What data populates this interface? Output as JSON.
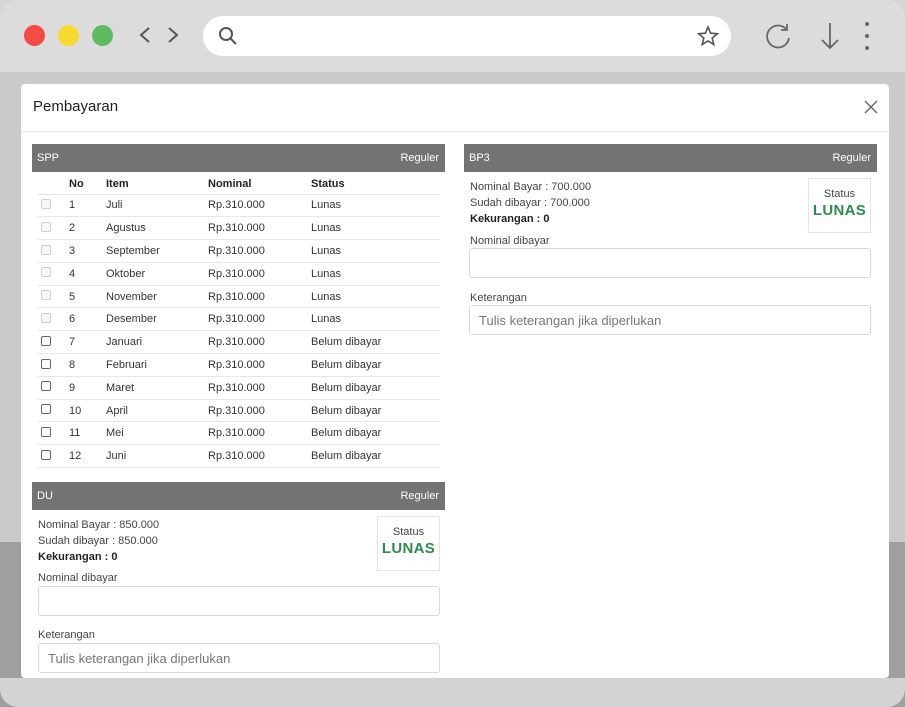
{
  "modal": {
    "title": "Pembayaran"
  },
  "spp": {
    "title": "SPP",
    "type": "Reguler",
    "headers": [
      "No",
      "Item",
      "Nominal",
      "Status"
    ],
    "rows": [
      {
        "no": "1",
        "item": "Juli",
        "nominal": "Rp.310.000",
        "status": "Lunas",
        "paid": true
      },
      {
        "no": "2",
        "item": "Agustus",
        "nominal": "Rp.310.000",
        "status": "Lunas",
        "paid": true
      },
      {
        "no": "3",
        "item": "September",
        "nominal": "Rp.310.000",
        "status": "Lunas",
        "paid": true
      },
      {
        "no": "4",
        "item": "Oktober",
        "nominal": "Rp.310.000",
        "status": "Lunas",
        "paid": true
      },
      {
        "no": "5",
        "item": "November",
        "nominal": "Rp.310.000",
        "status": "Lunas",
        "paid": true
      },
      {
        "no": "6",
        "item": "Desember",
        "nominal": "Rp.310.000",
        "status": "Lunas",
        "paid": true
      },
      {
        "no": "7",
        "item": "Januari",
        "nominal": "Rp.310.000",
        "status": "Belum dibayar",
        "paid": false
      },
      {
        "no": "8",
        "item": "Februari",
        "nominal": "Rp.310.000",
        "status": "Belum dibayar",
        "paid": false
      },
      {
        "no": "9",
        "item": "Maret",
        "nominal": "Rp.310.000",
        "status": "Belum dibayar",
        "paid": false
      },
      {
        "no": "10",
        "item": "April",
        "nominal": "Rp.310.000",
        "status": "Belum dibayar",
        "paid": false
      },
      {
        "no": "11",
        "item": "Mei",
        "nominal": "Rp.310.000",
        "status": "Belum dibayar",
        "paid": false
      },
      {
        "no": "12",
        "item": "Juni",
        "nominal": "Rp.310.000",
        "status": "Belum dibayar",
        "paid": false
      }
    ]
  },
  "du": {
    "title": "DU",
    "type": "Reguler",
    "nominal_bayar": "Nominal Bayar : 850.000",
    "sudah_dibayar": "Sudah dibayar : 850.000",
    "kekurangan": "Kekurangan : 0",
    "status_label": "Status",
    "status_value": "LUNAS",
    "nominal_dibayar_label": "Nominal dibayar",
    "nominal_dibayar_value": "",
    "keterangan_label": "Keterangan",
    "keterangan_placeholder": "Tulis keterangan jika diperlukan"
  },
  "bp3": {
    "title": "BP3",
    "type": "Reguler",
    "nominal_bayar": "Nominal Bayar : 700.000",
    "sudah_dibayar": "Sudah dibayar : 700.000",
    "kekurangan": "Kekurangan : 0",
    "status_label": "Status",
    "status_value": "LUNAS",
    "nominal_dibayar_label": "Nominal dibayar",
    "nominal_dibayar_value": "",
    "keterangan_label": "Keterangan",
    "keterangan_placeholder": "Tulis keterangan jika diperlukan"
  },
  "colors": {
    "panel_header": "#737373",
    "lunas": "#2e8b4e",
    "belum": "#d23a3a",
    "close_red": "#f44b45",
    "minimize_yellow": "#f8d92f",
    "maximize_green": "#5fbb62"
  },
  "icons": {
    "browser": [
      "close-dot",
      "minimize-dot",
      "maximize-dot",
      "back-arrow-icon",
      "forward-arrow-icon",
      "search-icon",
      "star-icon",
      "reload-icon",
      "download-icon",
      "kebab-menu-icon"
    ],
    "modal": [
      "close-icon"
    ]
  }
}
